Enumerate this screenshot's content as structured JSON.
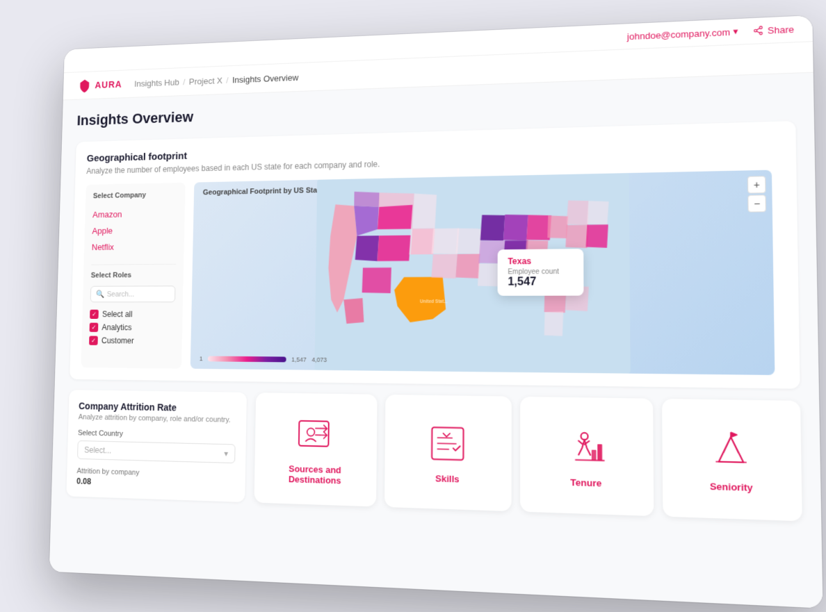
{
  "header": {
    "user_email": "johndoe@company.com",
    "share_label": "Share",
    "user_chevron": "▾"
  },
  "nav": {
    "logo_text": "AURA",
    "breadcrumb": {
      "part1": "Insights Hub",
      "separator1": "/",
      "part2": "Project X",
      "separator2": "/",
      "current": "Insights Overview"
    }
  },
  "page": {
    "title": "Insights Overview"
  },
  "geo_section": {
    "title": "Geographical footprint",
    "subtitle": "Analyze the number of employees based in each US state for each company and role.",
    "map_title": "Geographical Footprint by US State",
    "select_company_label": "Select Company",
    "companies": [
      "Amazon",
      "Apple",
      "Netflix"
    ],
    "select_roles_label": "Select Roles",
    "search_placeholder": "Search...",
    "checkboxes": [
      {
        "label": "Select all",
        "checked": true
      },
      {
        "label": "Analytics",
        "checked": true
      },
      {
        "label": "Customer",
        "checked": true
      }
    ],
    "zoom_plus": "+",
    "zoom_minus": "−",
    "download_icon": "⬇",
    "tooltip": {
      "state": "Texas",
      "label": "Employee count",
      "value": "1,547"
    },
    "legend": {
      "min": "1",
      "mid": "1,547",
      "max": "4,073"
    }
  },
  "attrition": {
    "title": "Company Attrition Rate",
    "subtitle": "Analyze attrition by company, role and/or country.",
    "select_country_label": "Select Country",
    "select_placeholder": "Select...",
    "by_company_label": "Attrition by company",
    "by_company_value": "0.08"
  },
  "feature_cards": [
    {
      "label": "Sources and Destinations",
      "icon": "sources"
    },
    {
      "label": "Skills",
      "icon": "skills"
    },
    {
      "label": "Tenure",
      "icon": "tenure"
    },
    {
      "label": "Seniority",
      "icon": "seniority"
    }
  ]
}
